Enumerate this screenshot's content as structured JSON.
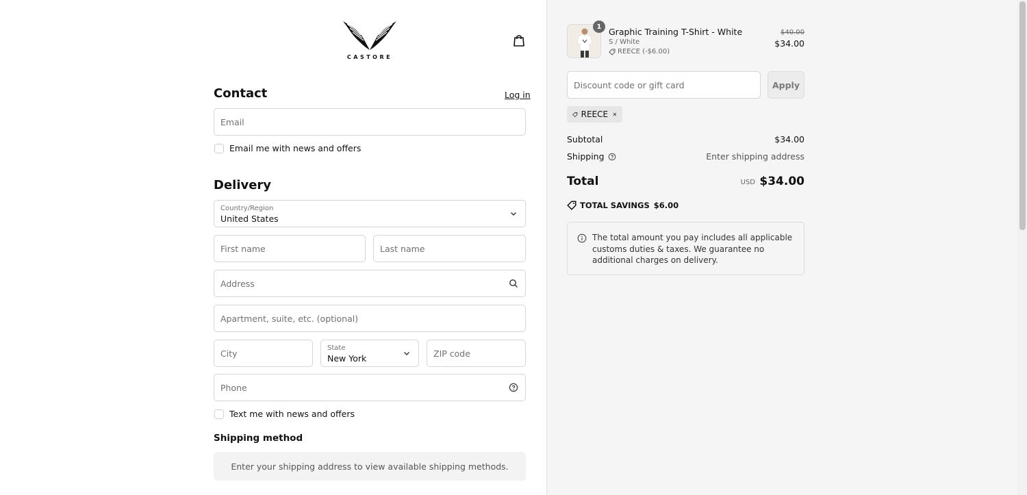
{
  "brand": {
    "name": "CASTORE"
  },
  "contact": {
    "heading": "Contact",
    "login_label": "Log in",
    "email_placeholder": "Email",
    "email_optin_label": "Email me with news and offers"
  },
  "delivery": {
    "heading": "Delivery",
    "country_label": "Country/Region",
    "country_value": "United States",
    "first_name_placeholder": "First name",
    "last_name_placeholder": "Last name",
    "address_placeholder": "Address",
    "apartment_placeholder": "Apartment, suite, etc. (optional)",
    "city_placeholder": "City",
    "state_label": "State",
    "state_value": "New York",
    "zip_placeholder": "ZIP code",
    "phone_placeholder": "Phone",
    "sms_optin_label": "Text me with news and offers"
  },
  "shipping_method": {
    "heading": "Shipping method",
    "message": "Enter your shipping address to view available shipping methods."
  },
  "cart": {
    "item": {
      "title": "Graphic Training T-Shirt - White",
      "variant": "S / White",
      "discount": "REECE (-$6.00)",
      "quantity": "1",
      "original_price": "$40.00",
      "price": "$34.00"
    },
    "discount_placeholder": "Discount code or gift card",
    "apply_label": "Apply",
    "applied_code": "REECE",
    "subtotal_label": "Subtotal",
    "subtotal_value": "$34.00",
    "shipping_label": "Shipping",
    "shipping_value": "Enter shipping address",
    "total_label": "Total",
    "total_currency": "USD",
    "total_value": "$34.00",
    "savings_label": "TOTAL SAVINGS",
    "savings_value": "$6.00",
    "duties_notice": "The total amount you pay includes all applicable customs duties & taxes. We guarantee no additional charges on delivery."
  },
  "icons": [
    "castore-logo",
    "bag-icon",
    "chevron-down-icon",
    "search-icon",
    "help-circle-icon",
    "tag-icon",
    "close-icon",
    "info-icon"
  ]
}
